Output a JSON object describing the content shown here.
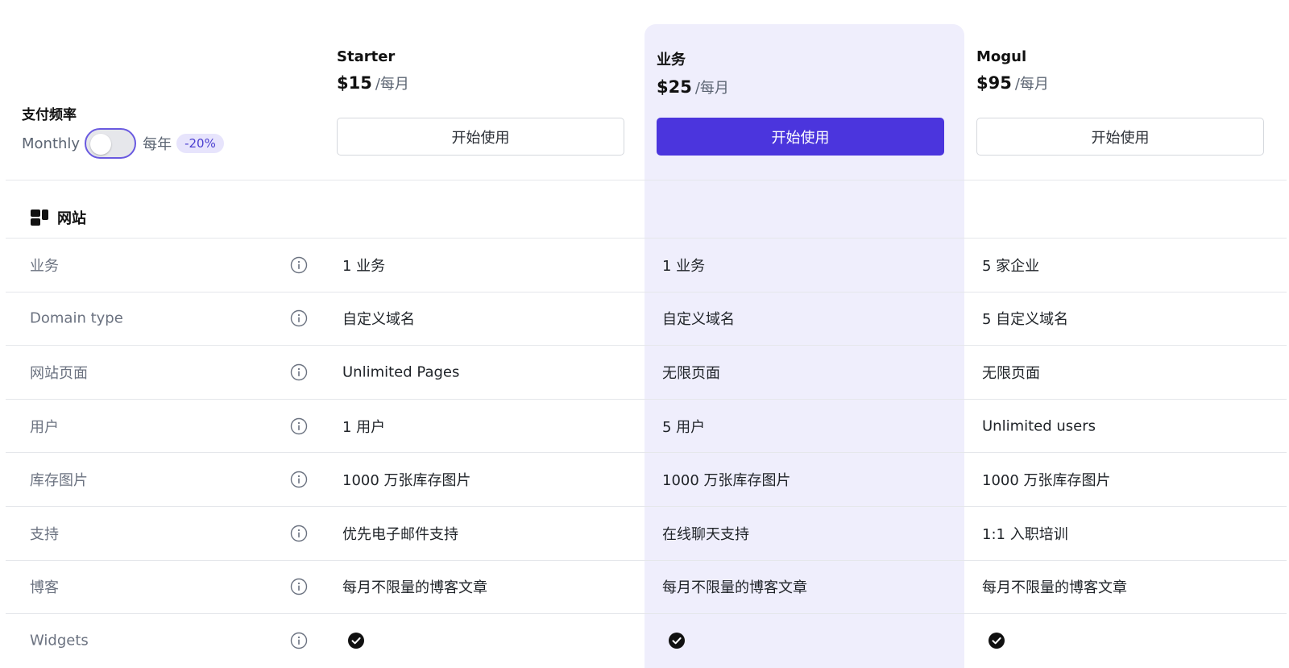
{
  "billing": {
    "title": "支付频率",
    "monthly_label": "Monthly",
    "yearly_label": "每年",
    "discount_badge": "-20%",
    "toggle_state": "monthly"
  },
  "plans": [
    {
      "name": "Starter",
      "price": "$15",
      "period": "/每月",
      "cta": "开始使用",
      "highlighted": false
    },
    {
      "name": "业务",
      "price": "$25",
      "period": "/每月",
      "cta": "开始使用",
      "highlighted": true
    },
    {
      "name": "Mogul",
      "price": "$95",
      "period": "/每月",
      "cta": "开始使用",
      "highlighted": false
    }
  ],
  "section": {
    "title": "网站",
    "icon": "layout-blocks-icon"
  },
  "rows": [
    {
      "label": "业务",
      "values": [
        "1 业务",
        "1 业务",
        "5 家企业"
      ]
    },
    {
      "label": "Domain type",
      "values": [
        "自定义域名",
        "自定义域名",
        "5 自定义域名"
      ]
    },
    {
      "label": "网站页面",
      "values": [
        "Unlimited Pages",
        "无限页面",
        "无限页面"
      ]
    },
    {
      "label": "用户",
      "values": [
        "1 用户",
        "5 用户",
        "Unlimited users"
      ]
    },
    {
      "label": "库存图片",
      "values": [
        "1000 万张库存图片",
        "1000 万张库存图片",
        "1000 万张库存图片"
      ]
    },
    {
      "label": "支持",
      "values": [
        "优先电子邮件支持",
        "在线聊天支持",
        "1:1 入职培训"
      ]
    },
    {
      "label": "博客",
      "values": [
        "每月不限量的博客文章",
        "每月不限量的博客文章",
        "每月不限量的博客文章"
      ]
    },
    {
      "label": "Widgets",
      "values": [
        null,
        null,
        null
      ],
      "included": [
        true,
        true,
        true
      ]
    }
  ],
  "colors": {
    "accent": "#4b35dd",
    "highlight_bg": "#efeefc",
    "badge_bg": "#e7e4fc",
    "muted_text": "#6b7280"
  }
}
